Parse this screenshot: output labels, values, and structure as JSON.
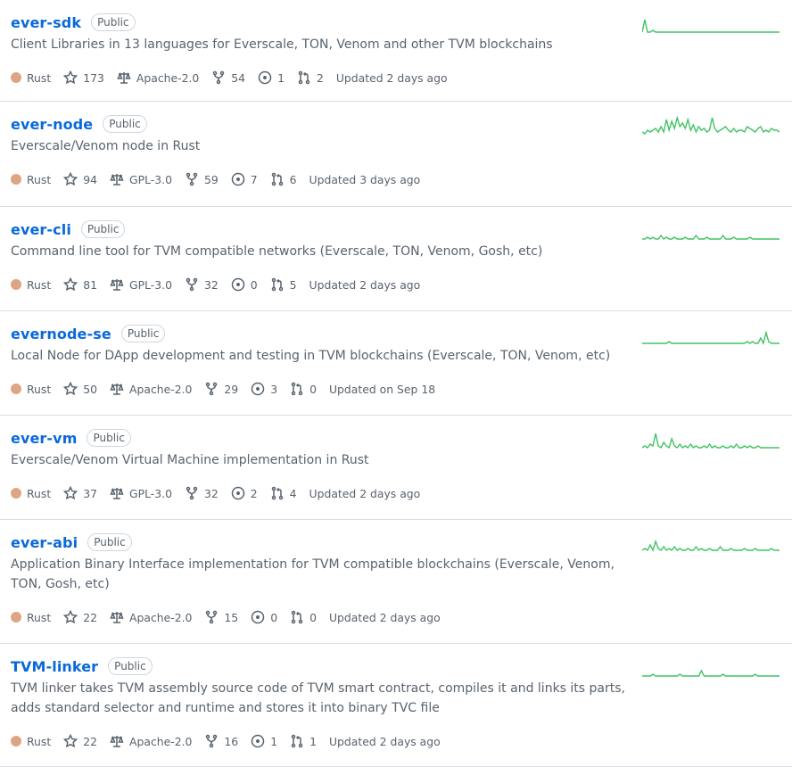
{
  "repos": [
    {
      "name": "ever-sdk",
      "visibility": "Public",
      "description": "Client Libraries in 13 languages for Everscale, TON, Venom and other TVM blockchains",
      "language": "Rust",
      "language_color": "#dea584",
      "stars": "173",
      "license": "Apache-2.0",
      "forks": "54",
      "issues": "1",
      "pulls": "2",
      "updated": "Updated 2 days ago",
      "activity": [
        2,
        9,
        2,
        2,
        3,
        2,
        2,
        2,
        2,
        2,
        2,
        2,
        2,
        2,
        2,
        2,
        2,
        2,
        2,
        2,
        2,
        2,
        2,
        2,
        2,
        2,
        2,
        2,
        2,
        2,
        2,
        2,
        2,
        2,
        2,
        2,
        2,
        2,
        2,
        2,
        2,
        2,
        2,
        2,
        2,
        2,
        2,
        2,
        2,
        2,
        2,
        2
      ]
    },
    {
      "name": "ever-node",
      "visibility": "Public",
      "description": "Everscale/Venom node in Rust",
      "language": "Rust",
      "language_color": "#dea584",
      "stars": "94",
      "license": "GPL-3.0",
      "forks": "59",
      "issues": "7",
      "pulls": "6",
      "updated": "Updated 3 days ago",
      "activity": [
        3,
        2,
        4,
        3,
        4,
        5,
        3,
        6,
        3,
        10,
        4,
        9,
        5,
        11,
        6,
        8,
        5,
        10,
        4,
        7,
        3,
        6,
        4,
        5,
        3,
        4,
        11,
        5,
        3,
        4,
        5,
        6,
        4,
        3,
        5,
        3,
        4,
        4,
        3,
        6,
        5,
        4,
        3,
        5,
        6,
        3,
        4,
        3,
        5,
        4,
        4,
        3
      ]
    },
    {
      "name": "ever-cli",
      "visibility": "Public",
      "description": "Command line tool for TVM compatible networks (Everscale, TON, Venom, Gosh, etc)",
      "language": "Rust",
      "language_color": "#dea584",
      "stars": "81",
      "license": "GPL-3.0",
      "forks": "32",
      "issues": "0",
      "pulls": "5",
      "updated": "Updated 2 days ago",
      "activity": [
        2,
        2,
        3,
        2,
        3,
        2,
        2,
        4,
        2,
        3,
        2,
        2,
        3,
        2,
        2,
        2,
        3,
        2,
        2,
        2,
        4,
        2,
        2,
        2,
        3,
        2,
        2,
        2,
        2,
        2,
        4,
        2,
        2,
        2,
        3,
        2,
        2,
        2,
        2,
        2,
        3,
        2,
        2,
        2,
        2,
        2,
        2,
        2,
        2,
        2,
        2,
        2
      ]
    },
    {
      "name": "evernode-se",
      "visibility": "Public",
      "description": "Local Node for DApp development and testing in TVM blockchains (Everscale, TON, Venom, etc)",
      "language": "Rust",
      "language_color": "#dea584",
      "stars": "50",
      "license": "Apache-2.0",
      "forks": "29",
      "issues": "3",
      "pulls": "0",
      "updated": "Updated on Sep 18",
      "activity": [
        2,
        2,
        2,
        2,
        2,
        2,
        2,
        2,
        2,
        2,
        3,
        2,
        2,
        2,
        2,
        2,
        2,
        2,
        2,
        2,
        2,
        2,
        2,
        2,
        2,
        2,
        2,
        2,
        2,
        2,
        2,
        2,
        2,
        2,
        2,
        2,
        2,
        2,
        2,
        3,
        2,
        3,
        2,
        2,
        5,
        2,
        8,
        3,
        2,
        2,
        2,
        2
      ]
    },
    {
      "name": "ever-vm",
      "visibility": "Public",
      "description": "Everscale/Venom Virtual Machine implementation in Rust",
      "language": "Rust",
      "language_color": "#dea584",
      "stars": "37",
      "license": "GPL-3.0",
      "forks": "32",
      "issues": "2",
      "pulls": "4",
      "updated": "Updated 2 days ago",
      "activity": [
        2,
        3,
        2,
        4,
        3,
        10,
        3,
        2,
        5,
        3,
        2,
        7,
        3,
        2,
        4,
        2,
        3,
        2,
        4,
        2,
        3,
        2,
        2,
        3,
        2,
        4,
        2,
        3,
        2,
        2,
        3,
        2,
        2,
        3,
        2,
        4,
        2,
        2,
        3,
        2,
        3,
        2,
        2,
        3,
        2,
        2,
        2,
        2,
        2,
        2,
        2,
        2
      ]
    },
    {
      "name": "ever-abi",
      "visibility": "Public",
      "description": "Application Binary Interface implementation for TVM compatible blockchains (Everscale, Venom, TON, Gosh, etc)",
      "language": "Rust",
      "language_color": "#dea584",
      "stars": "22",
      "license": "Apache-2.0",
      "forks": "15",
      "issues": "0",
      "pulls": "0",
      "updated": "Updated 2 days ago",
      "activity": [
        3,
        4,
        3,
        6,
        3,
        8,
        4,
        3,
        5,
        3,
        4,
        3,
        5,
        3,
        4,
        3,
        3,
        4,
        3,
        3,
        5,
        3,
        4,
        3,
        3,
        4,
        3,
        3,
        3,
        5,
        3,
        3,
        3,
        4,
        3,
        3,
        3,
        3,
        4,
        3,
        3,
        3,
        4,
        3,
        3,
        3,
        3,
        3,
        4,
        3,
        3,
        3
      ]
    },
    {
      "name": "TVM-linker",
      "visibility": "Public",
      "description": "TVM linker takes TVM assembly source code of TVM smart contract, compiles it and links its parts, adds standard selector and runtime and stores it into binary TVC file",
      "language": "Rust",
      "language_color": "#dea584",
      "stars": "22",
      "license": "Apache-2.0",
      "forks": "16",
      "issues": "1",
      "pulls": "1",
      "updated": "Updated 2 days ago",
      "activity": [
        2,
        2,
        2,
        2,
        3,
        2,
        2,
        2,
        2,
        2,
        2,
        2,
        2,
        2,
        3,
        2,
        2,
        2,
        2,
        2,
        2,
        2,
        5,
        2,
        2,
        2,
        2,
        2,
        2,
        2,
        3,
        2,
        2,
        2,
        2,
        2,
        2,
        2,
        2,
        2,
        2,
        2,
        3,
        2,
        2,
        2,
        2,
        2,
        2,
        2,
        2,
        2
      ]
    }
  ]
}
